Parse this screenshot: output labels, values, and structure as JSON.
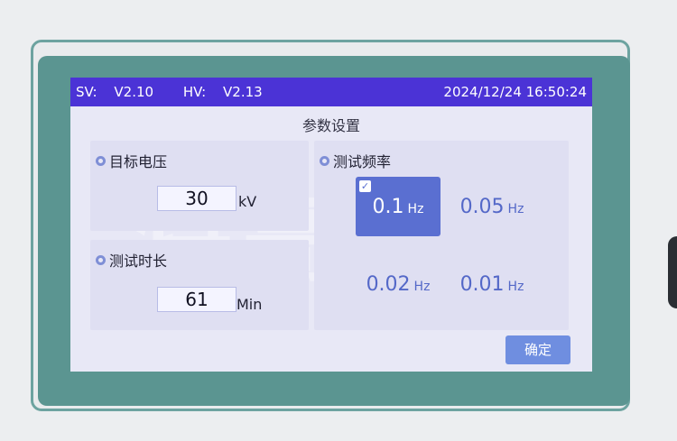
{
  "status_bar": {
    "sv_label": "SV:",
    "sv_value": "V2.10",
    "hv_label": "HV:",
    "hv_value": "V2.13",
    "datetime": "2024/12/24 16:50:24"
  },
  "page_title": "参数设置",
  "voltage": {
    "label": "目标电压",
    "value": "30",
    "unit": "kV"
  },
  "time": {
    "label": "测试时长",
    "value": "61",
    "unit": "Min"
  },
  "frequency": {
    "label": "测试频率",
    "options": [
      {
        "value": "0.1",
        "unit": "Hz",
        "selected": true
      },
      {
        "value": "0.05",
        "unit": "Hz",
        "selected": false
      },
      {
        "value": "0.02",
        "unit": "Hz",
        "selected": false
      },
      {
        "value": "0.01",
        "unit": "Hz",
        "selected": false
      }
    ]
  },
  "confirm_label": "确定",
  "watermark_text": "特高压",
  "colors": {
    "status_bar": "#4b33d6",
    "selected_cell": "#5a6fd1",
    "confirm_button": "#6f8ee0",
    "frame_teal": "#5b9591"
  },
  "icons": {
    "section_marker": "radio-dot-icon",
    "selected_marker": "checkbox-checked-icon"
  }
}
